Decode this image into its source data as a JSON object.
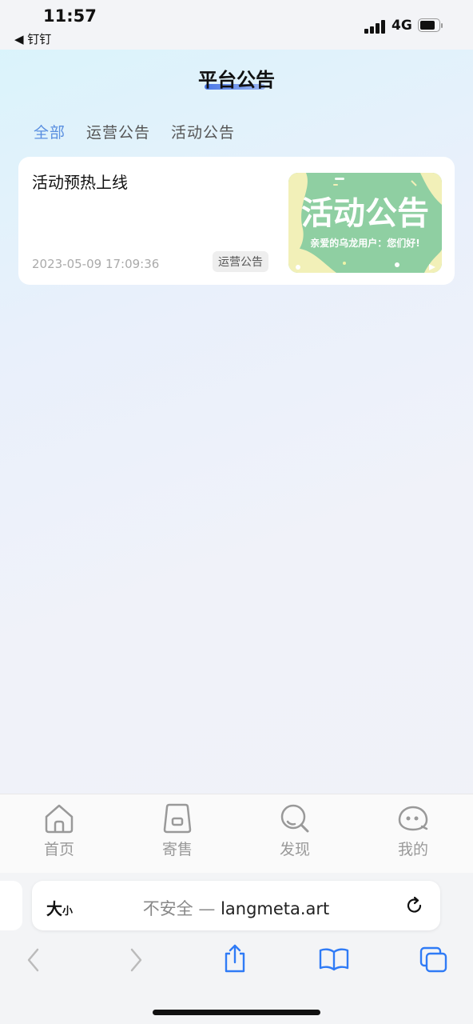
{
  "status_bar": {
    "time": "11:57",
    "back_app": "◀ 钉钉",
    "network": "4G"
  },
  "page": {
    "title": "平台公告"
  },
  "tabs": [
    {
      "label": "全部",
      "active": true
    },
    {
      "label": "运营公告",
      "active": false
    },
    {
      "label": "活动公告",
      "active": false
    }
  ],
  "announcements": [
    {
      "title": "活动预热上线",
      "date": "2023-05-09 17:09:36",
      "tag": "运营公告",
      "thumbnail": {
        "heading": "活动公告",
        "subtitle": "亲爱的乌龙用户：您们好!"
      }
    }
  ],
  "app_tabbar": [
    {
      "label": "首页",
      "icon": "home-icon"
    },
    {
      "label": "寄售",
      "icon": "bag-icon"
    },
    {
      "label": "发现",
      "icon": "discover-search-icon"
    },
    {
      "label": "我的",
      "icon": "profile-face-icon"
    }
  ],
  "browser": {
    "text_size_big": "大",
    "text_size_small": "小",
    "insecure_label": "不安全 —",
    "url": "langmeta.art"
  },
  "colors": {
    "accent": "#5a8fe0",
    "thumbnail_green": "#8fcfa2",
    "thumbnail_yellow": "#f2f0b8",
    "tab_inactive": "#999999"
  }
}
